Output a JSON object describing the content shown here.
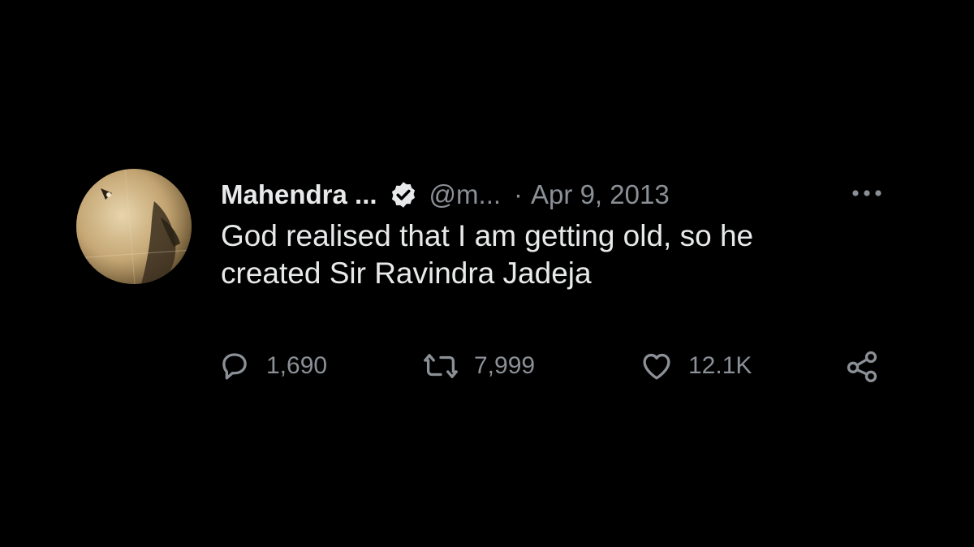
{
  "tweet": {
    "author_name": "Mahendra ...",
    "handle": "@m...",
    "separator": "·",
    "date": "Apr 9, 2013",
    "text_line1": "God realised that I am getting old, so he",
    "text_line2": "created Sir Ravindra Jadeja"
  },
  "actions": {
    "replies": "1,690",
    "retweets": "7,999",
    "likes": "12.1K"
  },
  "icons": {
    "verified": "verified-badge-icon",
    "more": "more-icon",
    "reply": "reply-icon",
    "retweet": "retweet-icon",
    "like": "heart-icon",
    "share": "share-icon"
  },
  "colors": {
    "background": "#000000",
    "text": "#e7e9ea",
    "muted": "#8b9096"
  }
}
